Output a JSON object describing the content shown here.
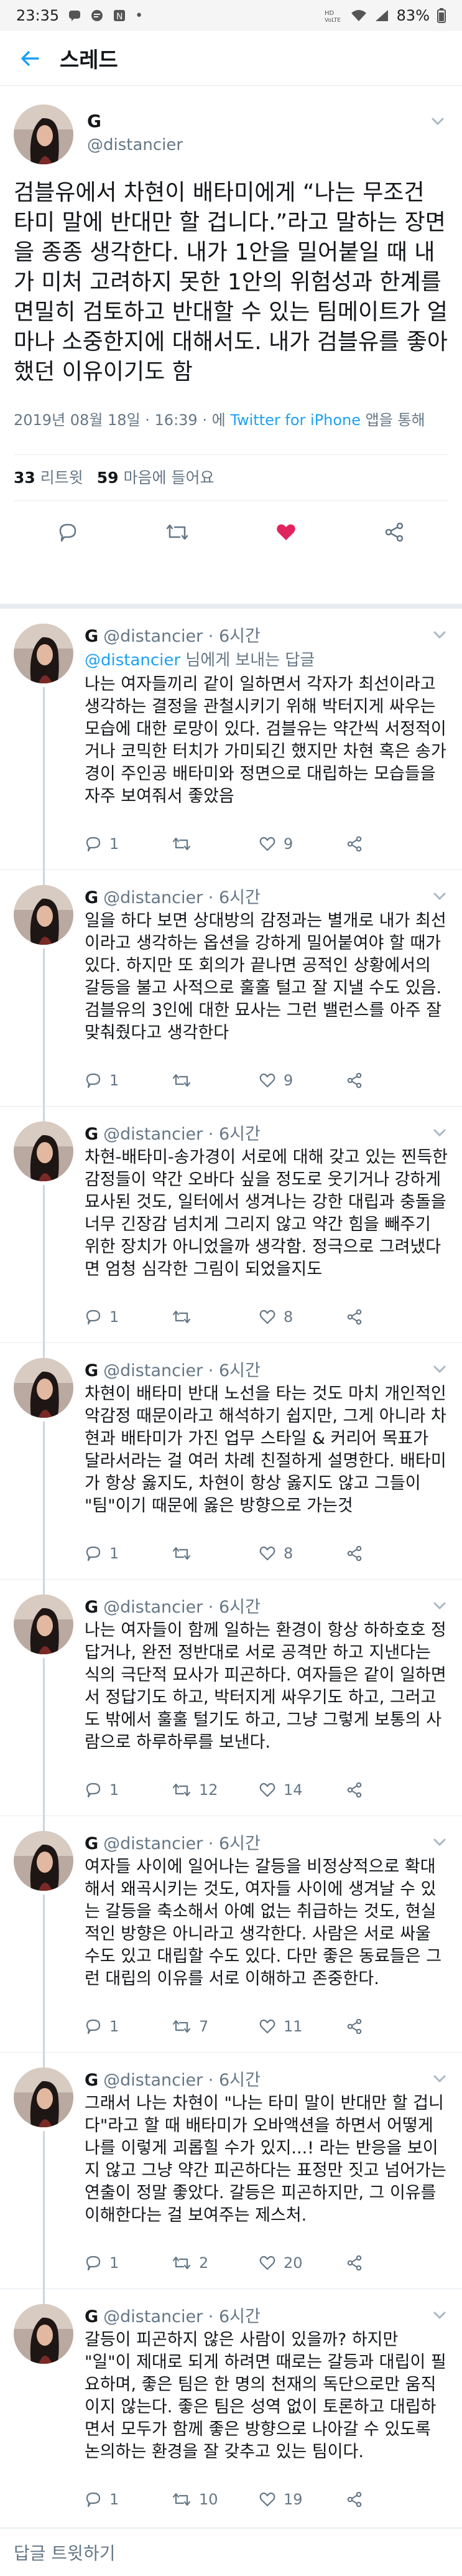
{
  "status_bar": {
    "time": "23:35",
    "battery": "83%",
    "icons": [
      "chat-notification-icon",
      "message-icon",
      "app-notification-icon",
      "more-dots-icon",
      "hd-volte-icon",
      "wifi-icon",
      "signal-icon",
      "battery-icon"
    ]
  },
  "header": {
    "title": "스레드",
    "back_icon": "back-arrow-icon"
  },
  "main_tweet": {
    "name": "G",
    "handle": "@distancier",
    "text": "검블유에서 차현이 배타미에게 “나는 무조건 타미 말에 반대만 할 겁니다.”라고 말하는 장면을 종종 생각한다. 내가 1안을 밀어붙일 때 내가 미처 고려하지 못한 1안의 위험성과 한계를 면밀히 검토하고 반대할 수 있는 팀메이트가 얼마나 소중한지에 대해서도. 내가 검블유를 좋아했던 이유이기도 함",
    "meta_prefix": "2019년 08월 18일 · 16:39 · 에 ",
    "meta_source": "Twitter for iPhone",
    "meta_suffix": " 앱을 통해",
    "retweets_count": "33",
    "retweets_label": "리트윗",
    "likes_count": "59",
    "likes_label": "마음에 들어요",
    "liked": true
  },
  "replies": [
    {
      "name": "G",
      "handle": "@distancier",
      "time": "6시간",
      "reply_to_handle": "@distancier",
      "reply_to_suffix": " 님에게 보내는 답글",
      "text": "나는 여자들끼리 같이 일하면서 각자가 최선이라고 생각하는 결정을 관철시키기 위해 박터지게 싸우는 모습에 대한 로망이 있다. 검블유는 약간씩 서정적이거나 코믹한 터치가 가미되긴 했지만 차현 혹은 송가경이 주인공 배타미와 정면으로 대립하는 모습들을 자주 보여줘서 좋았음",
      "replies": "1",
      "retweets": "",
      "likes": "9"
    },
    {
      "name": "G",
      "handle": "@distancier",
      "time": "6시간",
      "text": "일을 하다 보면 상대방의 감정과는 별개로 내가 최선이라고 생각하는 옵션을 강하게 밀어붙여야 할 때가 있다. 하지만 또 회의가 끝나면 공적인 상황에서의 갈등을 불고 사적으로 훌훌 털고 잘 지낼 수도 있음. 검블유의 3인에 대한 묘사는 그런 밸런스를 아주 잘 맞춰줬다고 생각한다",
      "replies": "1",
      "retweets": "",
      "likes": "9"
    },
    {
      "name": "G",
      "handle": "@distancier",
      "time": "6시간",
      "text": "차현-배타미-송가경이 서로에 대해 갖고 있는 찐득한 감정들이 약간 오바다 싶을 정도로 웃기거나 강하게 묘사된 것도, 일터에서 생겨나는 강한 대립과 충돌을 너무 긴장감 넘치게 그리지 않고 약간 힘을 빼주기 위한 장치가 아니었을까 생각함. 정극으로 그려냈다면 엄청 심각한 그림이 되었을지도",
      "replies": "1",
      "retweets": "",
      "likes": "8"
    },
    {
      "name": "G",
      "handle": "@distancier",
      "time": "6시간",
      "text": "차현이 배타미 반대 노선을 타는 것도 마치 개인적인 악감정 때문이라고 해석하기 쉽지만, 그게 아니라 차현과 배타미가 가진 업무 스타일 & 커리어 목표가 달라서라는 걸 여러 차례 친절하게 설명한다. 배타미가 항상 옳지도, 차현이 항상 옳지도 않고 그들이 \"팀\"이기 때문에 옳은 방향으로 가는것",
      "replies": "1",
      "retweets": "",
      "likes": "8"
    },
    {
      "name": "G",
      "handle": "@distancier",
      "time": "6시간",
      "text": "나는 여자들이 함께 일하는 환경이 항상 하하호호 정답거나, 완전 정반대로 서로 공격만 하고 지낸다는 식의 극단적 묘사가 피곤하다. 여자들은 같이 일하면서 정답기도 하고, 박터지게 싸우기도 하고, 그러고도 밖에서 훌훌 털기도 하고, 그냥 그렇게 보통의 사람으로 하루하루를 보낸다.",
      "replies": "1",
      "retweets": "12",
      "likes": "14"
    },
    {
      "name": "G",
      "handle": "@distancier",
      "time": "6시간",
      "text": "여자들 사이에 일어나는 갈등을 비정상적으로 확대해서 왜곡시키는 것도, 여자들 사이에 생겨날 수 있는 갈등을 축소해서 아예 없는 취급하는 것도, 현실적인 방향은 아니라고 생각한다. 사람은 서로 싸울 수도 있고 대립할 수도 있다. 다만 좋은 동료들은 그런 대립의 이유를 서로 이해하고 존중한다.",
      "replies": "1",
      "retweets": "7",
      "likes": "11"
    },
    {
      "name": "G",
      "handle": "@distancier",
      "time": "6시간",
      "text": "그래서 나는 차현이 \"나는 타미 말이 반대만 할 겁니다\"라고 할 때 배타미가 오바액션을 하면서 어떻게 나를 이렇게 괴롭힐 수가 있지...! 라는 반응을 보이지 않고 그냥 약간 피곤하다는 표정만 짓고 넘어가는 연출이 정말 좋았다. 갈등은 피곤하지만, 그 이유를 이해한다는 걸 보여주는 제스처.",
      "replies": "1",
      "retweets": "2",
      "likes": "20"
    },
    {
      "name": "G",
      "handle": "@distancier",
      "time": "6시간",
      "text": "갈등이 피곤하지 않은 사람이 있을까? 하지만 \"일\"이 제대로 되게 하려면 때로는 갈등과 대립이 필요하며, 좋은 팀은 한 명의 천재의 독단으로만 움직이지 않는다. 좋은 팀은 성역 없이 토론하고 대립하면서 모두가 함께 좋은 방향으로 나아갈 수 있도록 논의하는 환경을 잘 갖추고 있는 팀이다.",
      "replies": "1",
      "retweets": "10",
      "likes": "19"
    }
  ],
  "footer": {
    "reply_label": "답글 트윗하기"
  },
  "colors": {
    "accent": "#1da1f2",
    "like": "#e0245e",
    "muted": "#657786",
    "text": "#14171a"
  }
}
